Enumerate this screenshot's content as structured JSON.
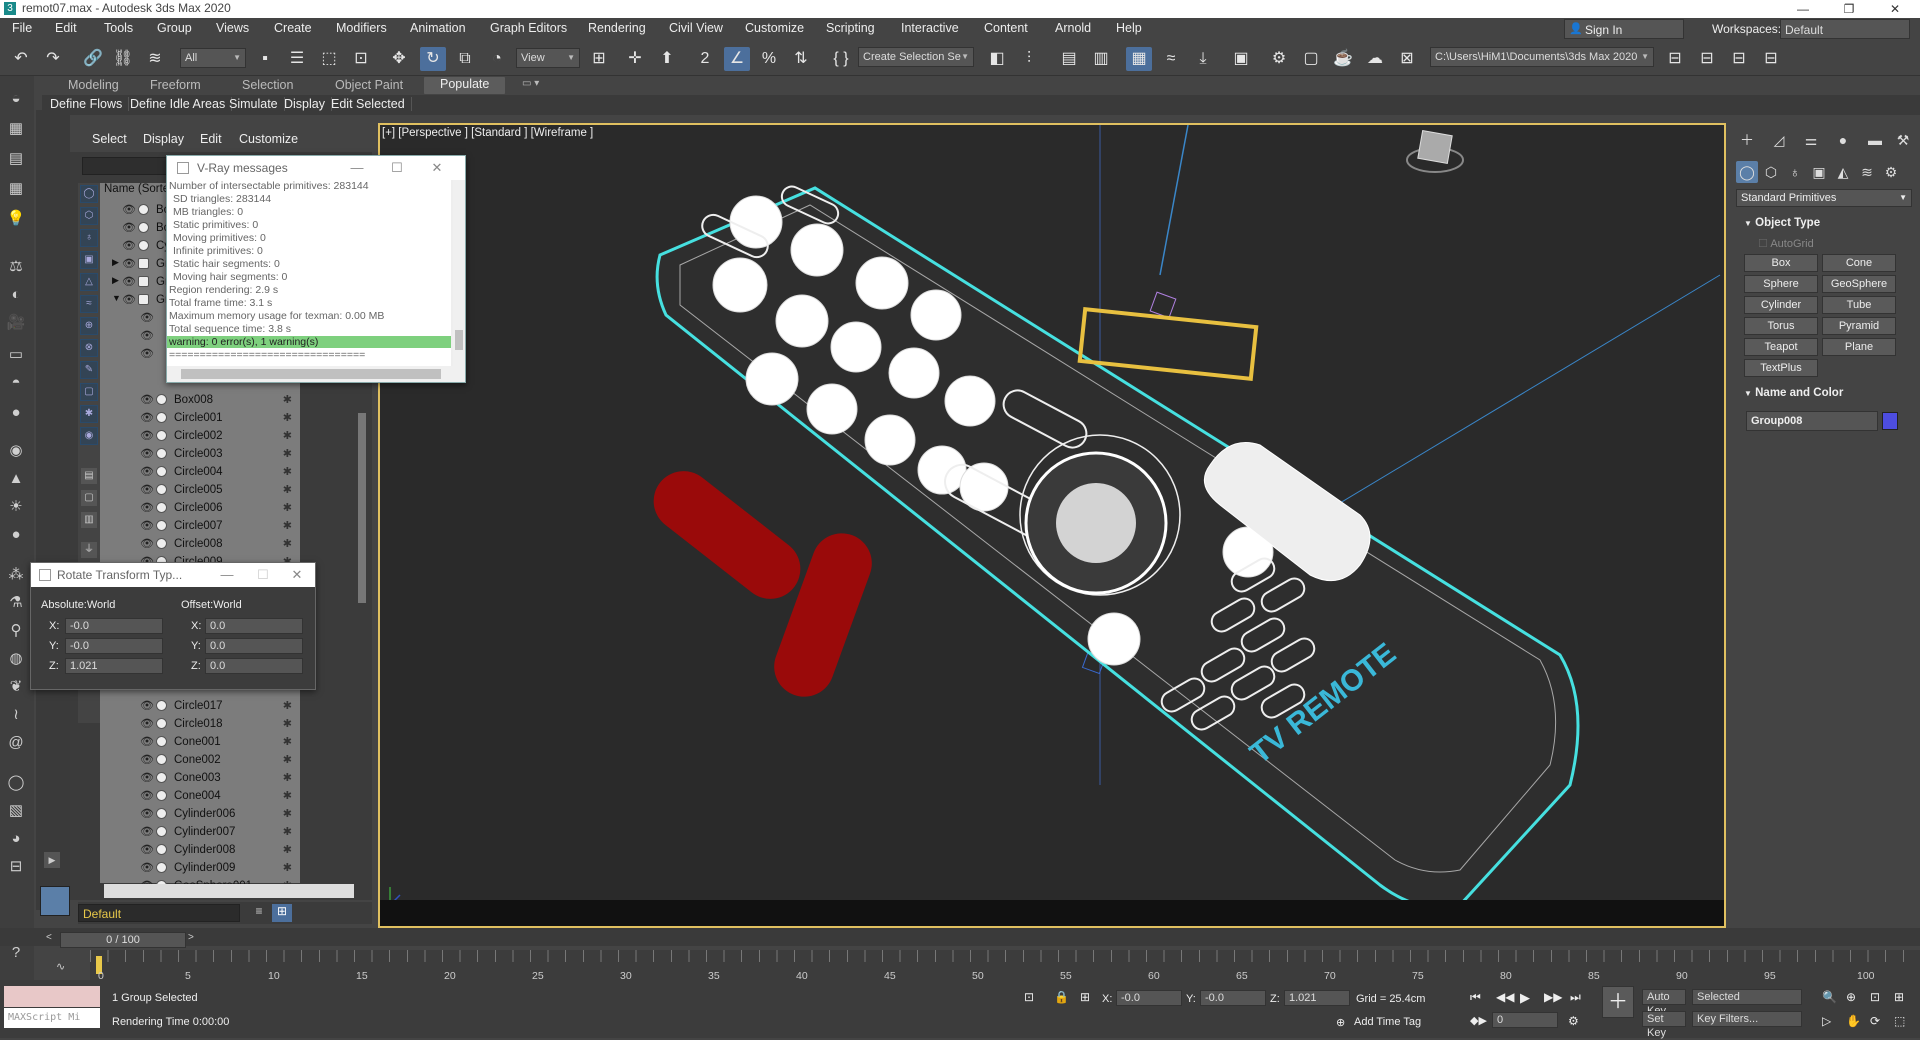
{
  "window": {
    "title": "remot07.max - Autodesk 3ds Max 2020"
  },
  "menu": [
    "File",
    "Edit",
    "Tools",
    "Group",
    "Views",
    "Create",
    "Modifiers",
    "Animation",
    "Graph Editors",
    "Rendering",
    "Civil View",
    "Customize",
    "Scripting",
    "Interactive",
    "Content",
    "Arnold",
    "Help"
  ],
  "account": {
    "sign_in": "Sign In",
    "workspaces_label": "Workspaces:",
    "workspace": "Default"
  },
  "toolbar": {
    "filter": "All",
    "ref_coord": "View",
    "selection_set": "Create Selection Se",
    "project_path": "C:\\Users\\HiM1\\Documents\\3ds Max 2020"
  },
  "ribbon": {
    "tabs": [
      "Modeling",
      "Freeform",
      "Selection",
      "Object Paint",
      "Populate"
    ],
    "active": "Populate",
    "subtabs": [
      "Define Flows",
      "Define Idle Areas",
      "Simulate",
      "Display",
      "Edit Selected"
    ]
  },
  "scene_explorer": {
    "menu": [
      "Select",
      "Display",
      "Edit",
      "Customize"
    ],
    "column": "Name (Sorte",
    "items": [
      "Bo",
      "Bo",
      "Cy",
      "Gr",
      "Gr",
      "Gr",
      "",
      "",
      "",
      "Box008",
      "Circle001",
      "Circle002",
      "Circle003",
      "Circle004",
      "Circle005",
      "Circle006",
      "Circle007",
      "Circle008",
      "Circle009",
      "",
      "",
      "",
      "",
      "",
      "",
      "",
      "",
      "Circle017",
      "Circle018",
      "Cone001",
      "Cone002",
      "Cone003",
      "Cone004",
      "Cylinder006",
      "Cylinder007",
      "Cylinder008",
      "Cylinder009",
      "GeoSphere001"
    ],
    "layer": "Default"
  },
  "vray": {
    "title": "V-Ray messages",
    "lines": [
      "Number of intersectable primitives: 283144",
      "SD triangles: 283144",
      "MB triangles: 0",
      "Static primitives: 0",
      "Moving primitives: 0",
      "Infinite primitives: 0",
      "Static hair segments: 0",
      "Moving hair segments: 0",
      "Region rendering: 2.9 s",
      "Total frame time: 3.1 s",
      "Maximum memory usage for texman: 0.00 MB",
      "Total sequence time: 3.8 s"
    ],
    "warning": "warning: 0 error(s), 1 warning(s)",
    "separator": "================================"
  },
  "rotate_dialog": {
    "title": "Rotate Transform Typ...",
    "absolute": {
      "label": "Absolute:World",
      "x": "-0.0",
      "y": "-0.0",
      "z": "1.021"
    },
    "offset": {
      "label": "Offset:World",
      "x": "0.0",
      "y": "0.0",
      "z": "0.0"
    }
  },
  "viewport": {
    "label": "[+] [Perspective ] [Standard ] [Wireframe ]",
    "remote_text": "TV REMOTE"
  },
  "command_panel": {
    "category": "Standard Primitives",
    "object_type": "Object Type",
    "autogrid": "AutoGrid",
    "buttons": [
      "Box",
      "Cone",
      "Sphere",
      "GeoSphere",
      "Cylinder",
      "Tube",
      "Torus",
      "Pyramid",
      "Teapot",
      "Plane",
      "TextPlus"
    ],
    "name_and_color": "Name and Color",
    "name": "Group008",
    "color": "#4d4de0"
  },
  "timeline": {
    "frame": "0 / 100",
    "ticks": [
      "0",
      "5",
      "10",
      "15",
      "20",
      "25",
      "30",
      "35",
      "40",
      "45",
      "50",
      "55",
      "60",
      "65",
      "70",
      "75",
      "80",
      "85",
      "90",
      "95",
      "100"
    ]
  },
  "status": {
    "maxscript": "MAXScript Mi",
    "selection": "1 Group Selected",
    "render_time": "Rendering Time  0:00:00",
    "x": "-0.0",
    "y": "-0.0",
    "z": "1.021",
    "grid": "Grid = 25.4cm",
    "add_time_tag": "Add Time Tag",
    "auto_key": "Auto Key",
    "set_key": "Set Key",
    "key_mode": "Selected",
    "key_filters": "Key Filters...",
    "frame_field": "0"
  }
}
